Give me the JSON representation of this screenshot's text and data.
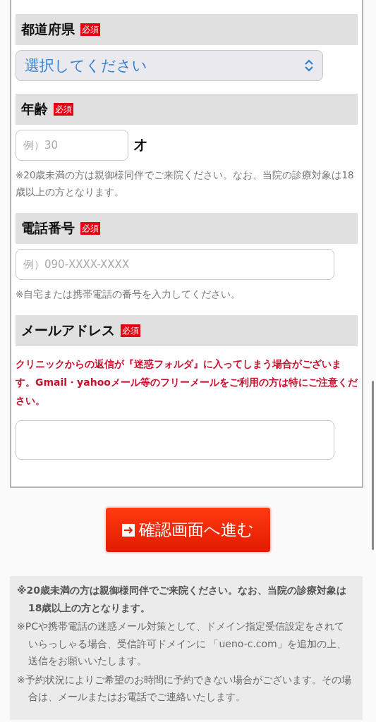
{
  "form": {
    "sections": [
      {
        "kind": "select",
        "label": "都道府県",
        "required_badge": "必須",
        "value": "選択してください"
      },
      {
        "kind": "input",
        "label": "年齢",
        "required_badge": "必須",
        "placeholder": "例）30",
        "suffix": "才",
        "note": "※20歳未満の方は親御様同伴でご来院ください。なお、当院の診療対象は18歳以上の方となります。"
      },
      {
        "kind": "input",
        "label": "電話番号",
        "required_badge": "必須",
        "placeholder": "例）090-XXXX-XXXX",
        "note": "※自宅または携帯電話の番号を入力してください。"
      },
      {
        "kind": "input",
        "label": "メールアドレス",
        "required_badge": "必須",
        "warning": "クリニックからの返信が『迷惑フォルダ』に入ってしまう場合がございます。Gmail・yahooメール等のフリーメールをご利用の方は特にご注意ください。"
      }
    ]
  },
  "submit_button": "確認画面へ進む",
  "notes": [
    {
      "text": "※20歳未満の方は親御様同伴でご来院ください。なお、当院の診療対象は18歳以上の方となります。",
      "bold": true
    },
    {
      "text": "※PCや携帯電話の迷惑メール対策として、ドメイン指定受信設定をされていらっしゃる場合、受信許可ドメインに 「ueno-c.com」を追加の上、送信をお願いいたします。",
      "bold": false
    },
    {
      "text": "※予約状況によりご希望のお時間に予約できない場合がございます。その場合は、メールまたはお電話でご連絡いたします。",
      "bold": false
    }
  ]
}
